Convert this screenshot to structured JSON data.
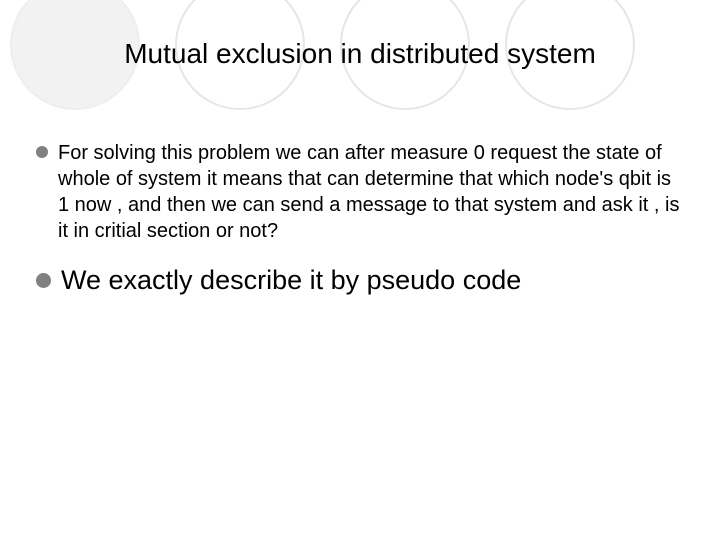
{
  "title": "Mutual exclusion in distributed system",
  "bullets": [
    {
      "text": "For solving this problem we can after measure 0 request the state of whole of system it means that can determine that which node's qbit is 1 now , and then we can send a message to that system and ask it , is it in critial section or not?"
    },
    {
      "text": "We exactly describe it by pseudo code"
    }
  ]
}
